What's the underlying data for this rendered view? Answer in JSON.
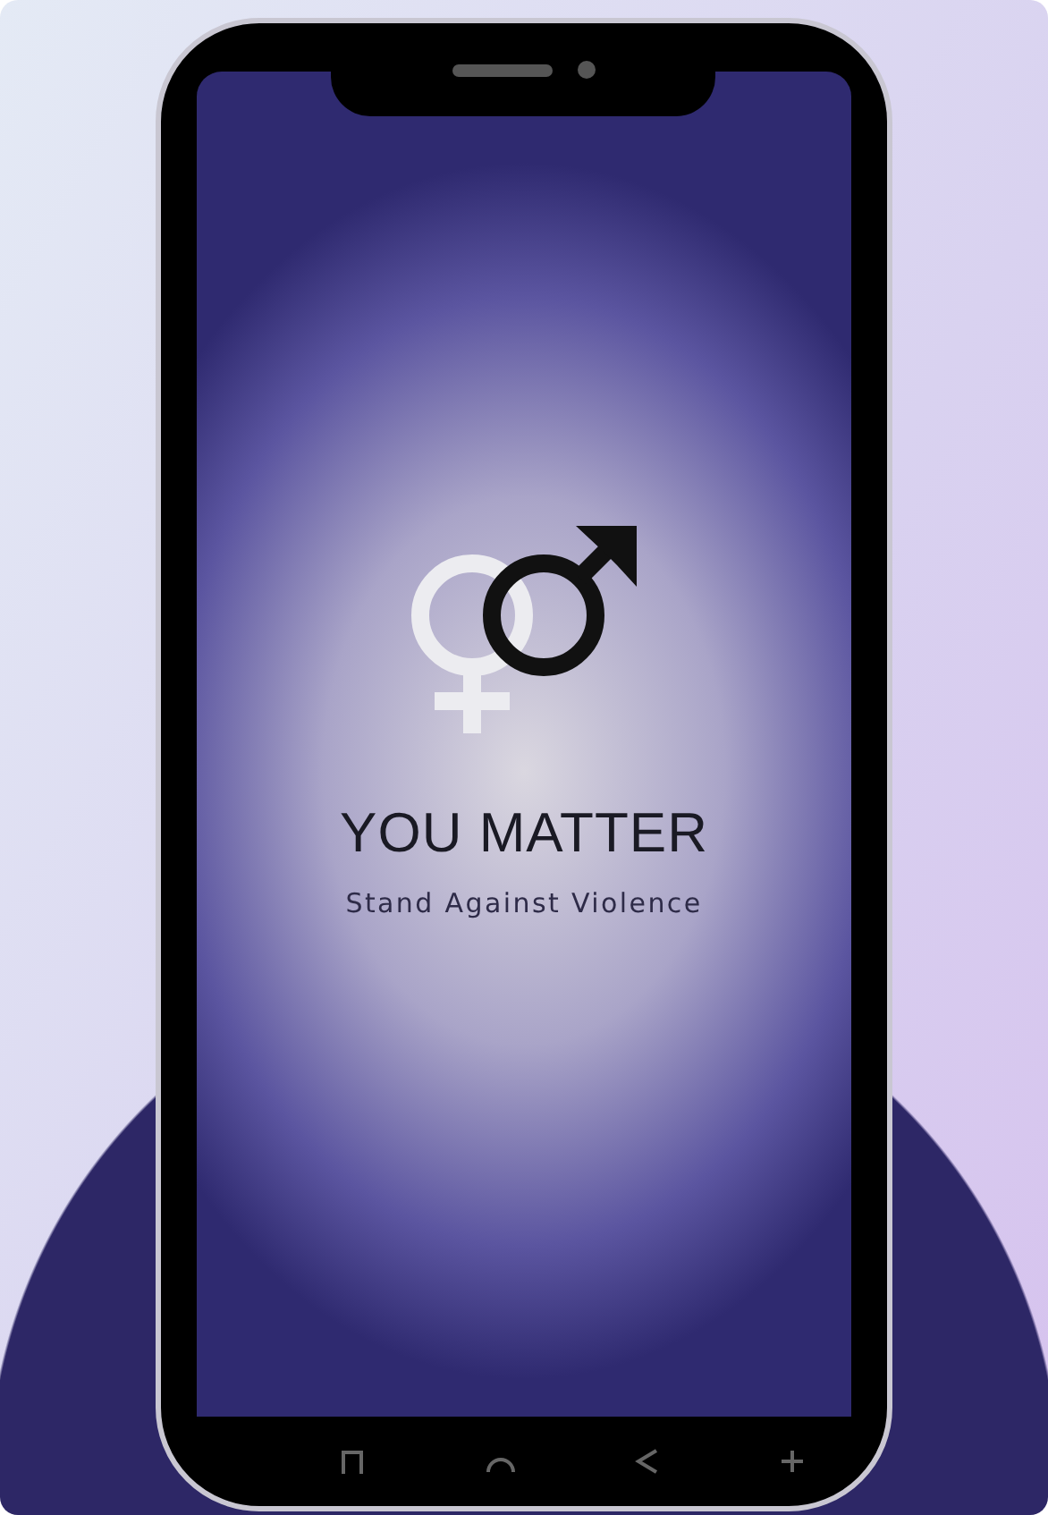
{
  "app": {
    "title": "YOU MATTER",
    "tagline": "Stand Against Violence"
  }
}
